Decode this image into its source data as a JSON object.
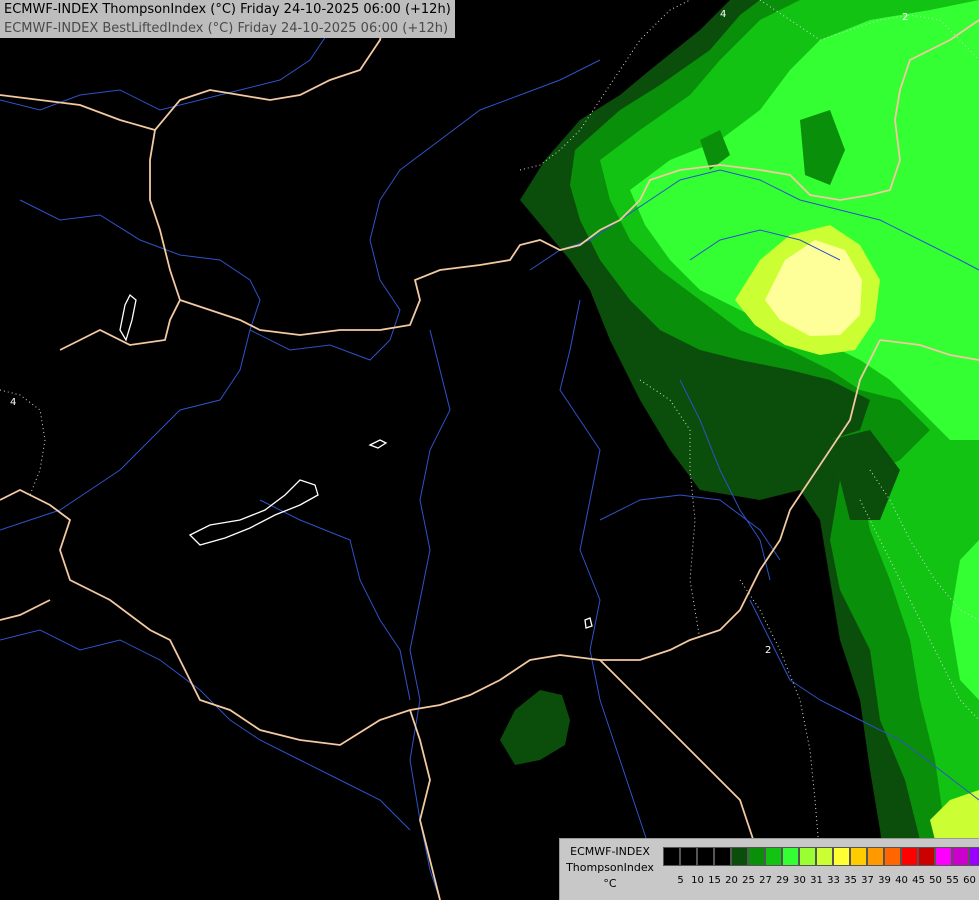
{
  "header": {
    "line1": "ECMWF-INDEX ThompsonIndex (°C) Friday 24-10-2025 06:00 (+12h)",
    "line2": "ECMWF-INDEX BestLiftedIndex (°C) Friday 24-10-2025 06:00 (+12h)"
  },
  "contour_labels": [
    "4",
    "2",
    "4",
    "2"
  ],
  "legend": {
    "title_line1": "ECMWF-INDEX",
    "title_line2": "ThompsonIndex",
    "unit": "°C",
    "ticks": [
      "5",
      "10",
      "15",
      "20",
      "25",
      "27",
      "29",
      "30",
      "31",
      "33",
      "35",
      "37",
      "39",
      "40",
      "45",
      "50",
      "55",
      "60"
    ],
    "colors": [
      "#000000",
      "#000000",
      "#000000",
      "#000000",
      "#0b4d0b",
      "#0a8f0a",
      "#13c313",
      "#33ff33",
      "#99ff33",
      "#ccff33",
      "#ffff33",
      "#ffcc00",
      "#ff9900",
      "#ff6600",
      "#ff0000",
      "#cc0000",
      "#ff00ff",
      "#cc00cc",
      "#9900ff",
      "#6633ff",
      "#0000ff"
    ]
  }
}
